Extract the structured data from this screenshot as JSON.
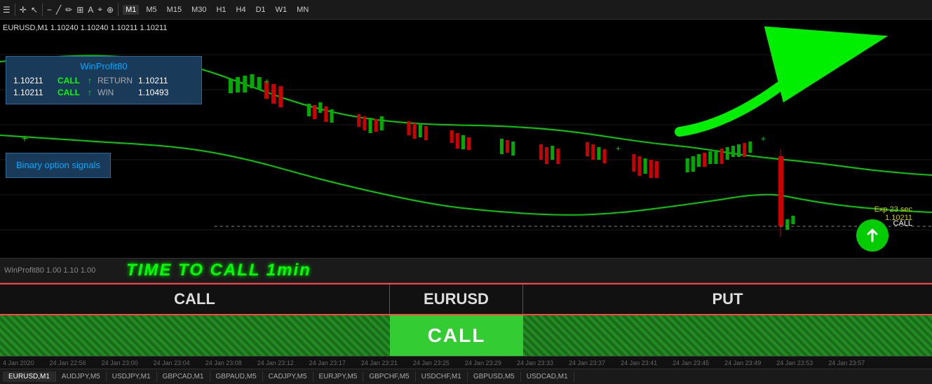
{
  "toolbar": {
    "timeframes": [
      "M1",
      "M5",
      "M15",
      "M30",
      "H1",
      "H4",
      "D1",
      "W1",
      "MN"
    ],
    "active_tf": "M1"
  },
  "chart": {
    "symbol": "EURUSD,M1",
    "prices": "1.10240  1.10240  1.10211  1.10211",
    "price_label": "EURUSD,M1  1.10240 1.10240 1.10211 1.10211"
  },
  "winprofit": {
    "title": "WinProfit80",
    "row1": {
      "price": "1.10211",
      "signal": "CALL",
      "arrow": "↑",
      "label": "RETURN",
      "value": "1.10211"
    },
    "row2": {
      "price": "1.10211",
      "signal": "CALL",
      "arrow": "↑",
      "label": "WIN",
      "value": "1.10493"
    }
  },
  "binary_signals": {
    "text": "Binary option signals"
  },
  "exp_info": {
    "line1": "Exp 23 sec",
    "line2": "1.10211"
  },
  "call_label": "CALL",
  "banner": {
    "left_text": "WinProfit80  1.00  1.10  1.00",
    "main_text": "TIME TO CALL 1min"
  },
  "action_row": {
    "call": "CALL",
    "symbol": "EURUSD",
    "put": "PUT"
  },
  "call_button": {
    "text": "CALL"
  },
  "time_axis": {
    "ticks": [
      "4 Jan 2020",
      "24 Jan 22:56",
      "24 Jan 23:00",
      "24 Jan 23:04",
      "24 Jan 23:08",
      "24 Jan 23:12",
      "24 Jan 23:17",
      "24 Jan 23:21",
      "24 Jan 23:25",
      "24 Jan 23:29",
      "24 Jan 23:33",
      "24 Jan 23:37",
      "24 Jan 23:41",
      "24 Jan 23:45",
      "24 Jan 23:49",
      "24 Jan 23:53",
      "24 Jan 23:57"
    ]
  },
  "symbol_tabs": [
    {
      "label": "EURUSD,M1",
      "active": true
    },
    {
      "label": "AUDJPY,M5",
      "active": false
    },
    {
      "label": "USDJPY,M1",
      "active": false
    },
    {
      "label": "GBPCAD,M1",
      "active": false
    },
    {
      "label": "GBPAUD,M5",
      "active": false
    },
    {
      "label": "CADJPY,M5",
      "active": false
    },
    {
      "label": "EURJPY,M5",
      "active": false
    },
    {
      "label": "GBPCHF,M5",
      "active": false
    },
    {
      "label": "USDCHF,M1",
      "active": false
    },
    {
      "label": "GBPUSD,M5",
      "active": false
    },
    {
      "label": "USDCAD,M1",
      "active": false
    }
  ]
}
